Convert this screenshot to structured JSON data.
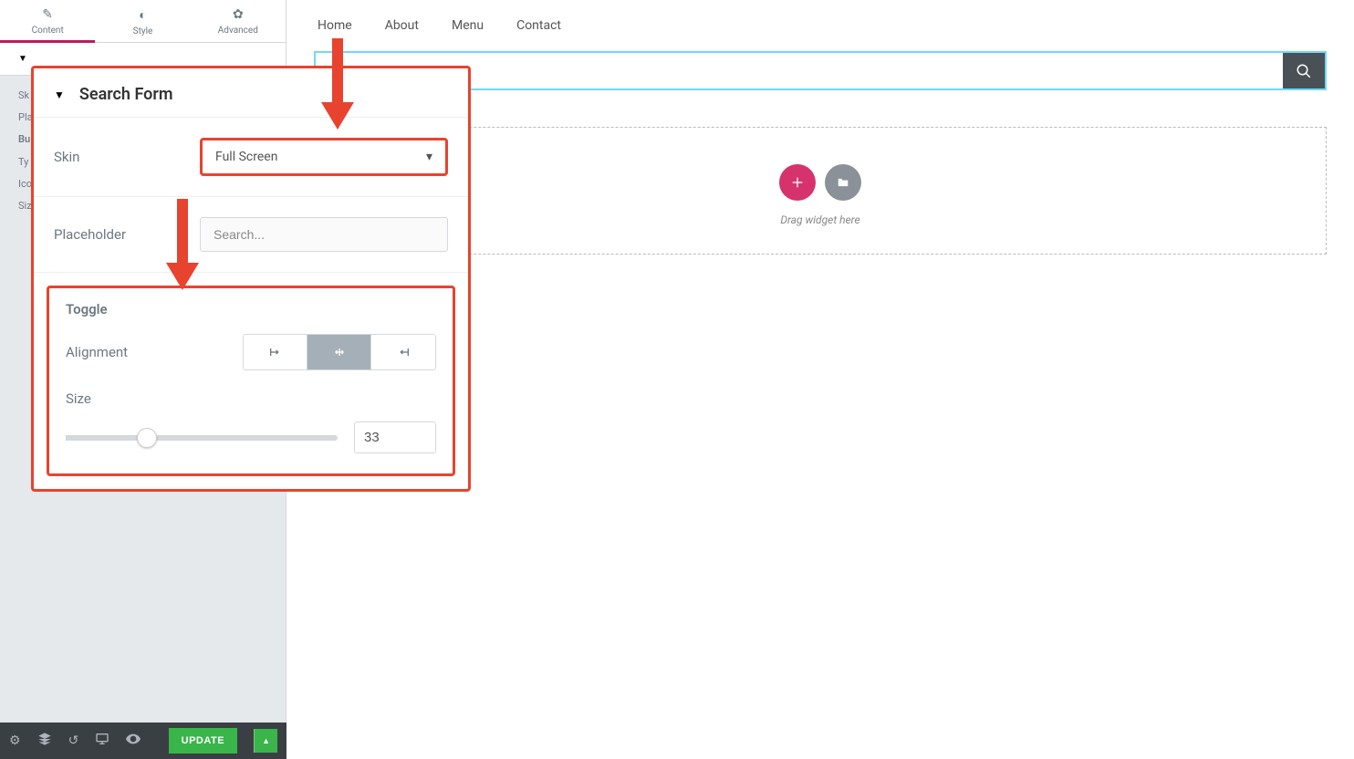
{
  "tabs": {
    "content": "Content",
    "style": "Style",
    "advanced": "Advanced"
  },
  "bgSection": {
    "items": [
      "Sk",
      "Pla",
      "Bu",
      "Ty",
      "Ico",
      "Siz"
    ]
  },
  "nav": [
    "Home",
    "About",
    "Menu",
    "Contact"
  ],
  "searchPlaceholder": "",
  "dropText": "Drag widget here",
  "bottombar": {
    "update": "Update"
  },
  "popup": {
    "title": "Search Form",
    "skinLabel": "Skin",
    "skinValue": "Full Screen",
    "placeholderLabel": "Placeholder",
    "placeholderValue": "Search...",
    "toggleTitle": "Toggle",
    "alignmentLabel": "Alignment",
    "sizeLabel": "Size",
    "sizeValue": "33"
  }
}
